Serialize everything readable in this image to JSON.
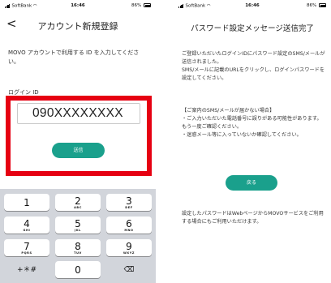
{
  "screen1": {
    "status": {
      "carrier": "SoftBank",
      "time": "16:46",
      "battery": "86%"
    },
    "nav": {
      "back_icon": "chevron-left-icon",
      "title": "アカウント新規登録"
    },
    "instruction": "MOVO アカウントで利用する ID を入力してください。",
    "login_id_label": "ログイン ID",
    "login_id_value": "090XXXXXXXX",
    "send_button": "送信",
    "highlight_color": "#e60012",
    "button_color": "#1aa08c",
    "keypad": {
      "keys": [
        {
          "num": "1",
          "letters": ""
        },
        {
          "num": "2",
          "letters": "ABC"
        },
        {
          "num": "3",
          "letters": "DEF"
        },
        {
          "num": "4",
          "letters": "GHI"
        },
        {
          "num": "5",
          "letters": "JKL"
        },
        {
          "num": "6",
          "letters": "MNO"
        },
        {
          "num": "7",
          "letters": "PQRS"
        },
        {
          "num": "8",
          "letters": "TUV"
        },
        {
          "num": "9",
          "letters": "WXYZ"
        },
        {
          "num": "+＊#",
          "letters": ""
        },
        {
          "num": "0",
          "letters": ""
        },
        {
          "num": "⌫",
          "letters": ""
        }
      ]
    }
  },
  "screen2": {
    "status": {
      "carrier": "SoftBank",
      "time": "16:46",
      "battery": "86%"
    },
    "title": "パスワード設定メッセージ送信完了",
    "message": "ご登録いただいたログインIDにパスワード設定のSMS/メールが送信されました。\nSMS/メールに記載のURLをクリックし、ログインパスワードを設定してください。",
    "notice": "【ご案内のSMS/メールが届かない場合】\n・ご入力いただいた電話番号に誤りがある可能性があります。もう一度ご確認ください。\n・迷惑メール等に入っていないか確認してください。",
    "return_button": "戻る",
    "footer": "設定したパスワードはWebページからMOVOサービスをご利用する場合にもご利用いただけます。"
  }
}
